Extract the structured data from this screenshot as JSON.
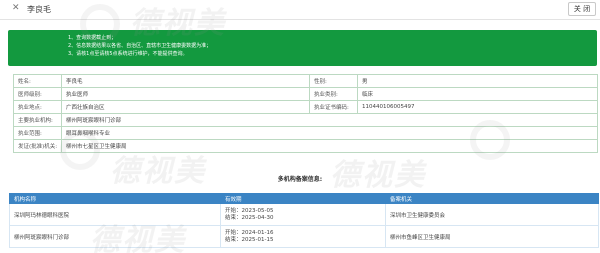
{
  "header": {
    "close_glyph": "✕",
    "title": "李良毛",
    "close_button": "关 闭"
  },
  "notice": {
    "lines": [
      "1、查询数据截止到；",
      "2、信息数据结果以各省、自治区、直辖市卫生健康委数据为准；",
      "3、请核1点至请核5点系统进行维护，不能提供查询。"
    ]
  },
  "info": {
    "rows": [
      {
        "l1": "姓名:",
        "v1": "李良毛",
        "l2": "性别:",
        "v2": "男"
      },
      {
        "l1": "医师级别:",
        "v1": "执业医师",
        "l2": "执业类别:",
        "v2": "临床"
      },
      {
        "l1": "执业地点:",
        "v1": "广西壮族自治区",
        "l2": "执业证书编码:",
        "v2": "110440106005497"
      },
      {
        "l1": "主要执业机构:",
        "v1": "柳州阿斑宸眼科门诊部"
      },
      {
        "l1": "执业范围:",
        "v1": "眼耳鼻咽喉科专业"
      },
      {
        "l1": "发证(批准)机关:",
        "v1": "柳州市七星区卫生健康局"
      }
    ]
  },
  "multi": {
    "title": "多机构备案信息:",
    "headers": [
      "机构名称",
      "有效期",
      "备案机关"
    ],
    "rows": [
      {
        "name": "深圳阿玛林德眼科医院",
        "start": "开始：2023-05-05",
        "end": "结束：2025-04-30",
        "authority": "深圳市卫生健康委员会"
      },
      {
        "name": "柳州阿斑宸眼科门诊部",
        "start": "开始：2024-01-16",
        "end": "结束：2025-01-15",
        "authority": "柳州市鱼峰区卫生健康局"
      }
    ]
  },
  "watermark": {
    "text": "德视美"
  },
  "colors": {
    "notice_bg": "#13993f",
    "table_header_bg": "#3b84c4"
  }
}
